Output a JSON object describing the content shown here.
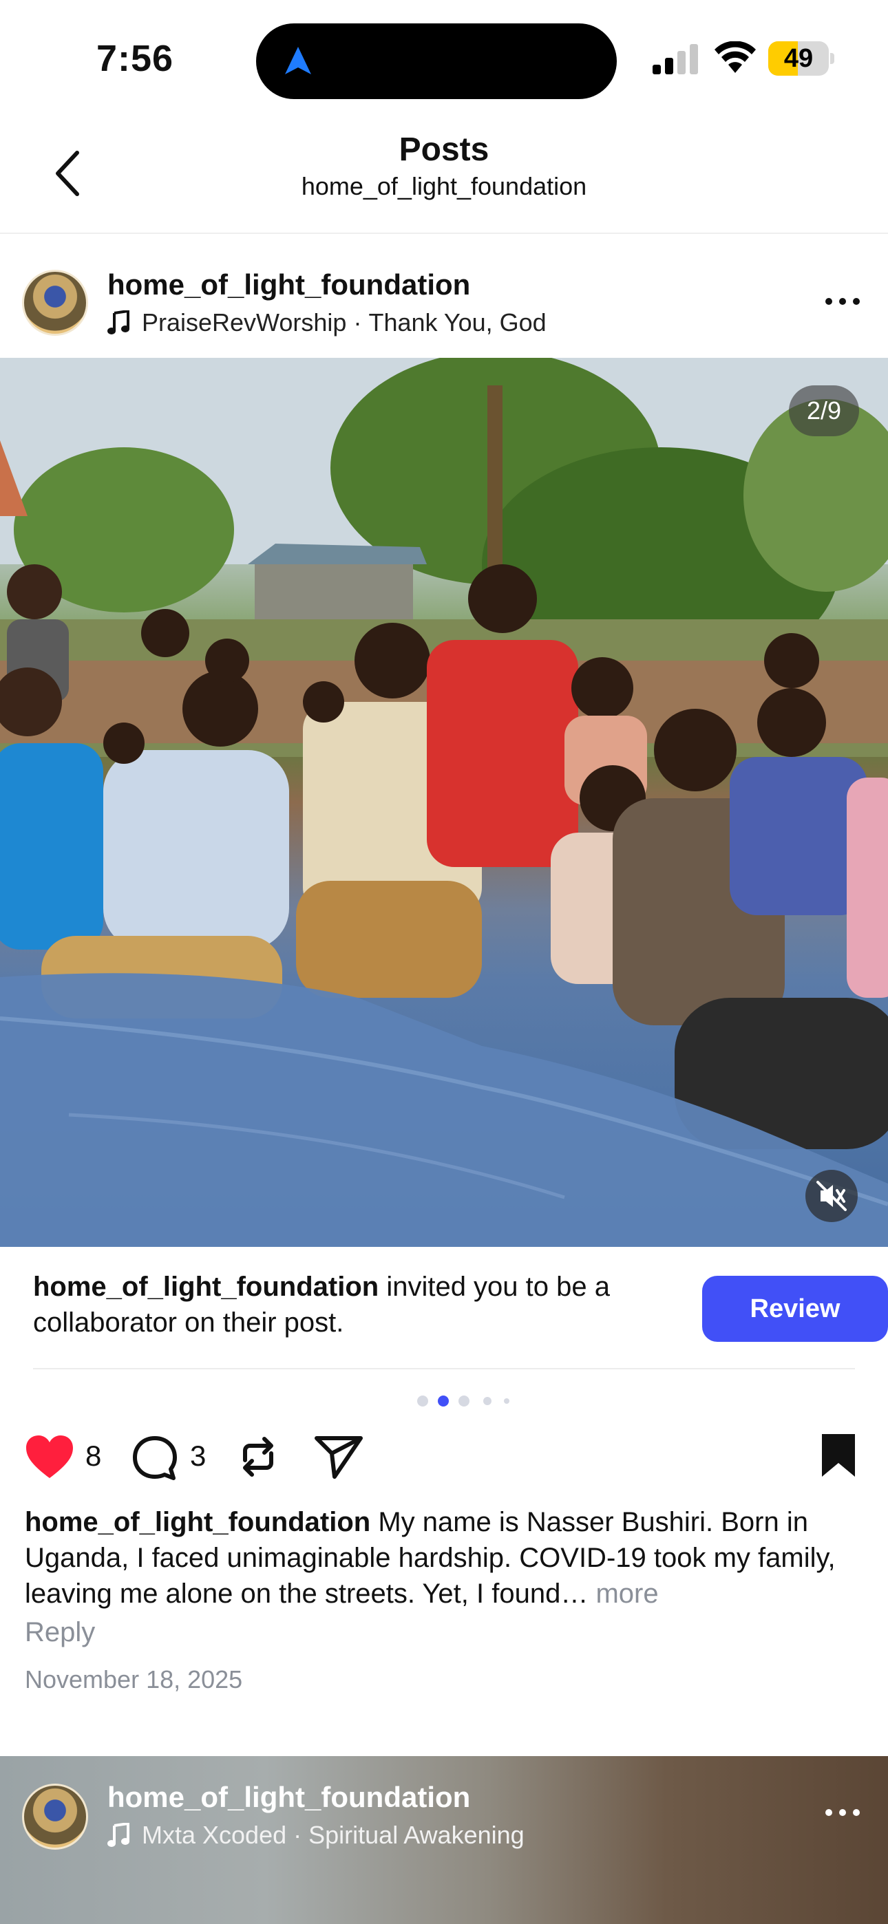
{
  "status_bar": {
    "time": "7:56",
    "battery_level": "49",
    "battery_fraction": 0.49,
    "accent": "#1f7cff"
  },
  "header": {
    "title": "Posts",
    "subtitle": "home_of_light_foundation"
  },
  "post": {
    "username": "home_of_light_foundation",
    "music_artist": "PraiseRevWorship",
    "music_separator": "·",
    "music_title": "Thank You, God",
    "media_counter": "2/9",
    "collab": {
      "username": "home_of_light_foundation",
      "text": "invited you to be a collaborator on their post.",
      "button_label": "Review",
      "button_color": "#4150f7"
    },
    "carousel_dots": {
      "count": 5,
      "active_index": 1
    },
    "likes": "8",
    "comments": "3",
    "liked": true,
    "like_color": "#ff1f3d",
    "bookmarked": true,
    "caption_username": "home_of_light_foundation",
    "caption_text": "My name is Nasser Bushiri. Born in Uganda, I faced unimaginable hardship. COVID-19 took my family, leaving me alone on the streets. Yet, I found…",
    "caption_more": "more",
    "reply_label": "Reply",
    "date": "November 18, 2025"
  },
  "next_post": {
    "username": "home_of_light_foundation",
    "music_artist": "Mxta Xcoded",
    "music_separator": "·",
    "music_title": "Spiritual Awakening"
  }
}
